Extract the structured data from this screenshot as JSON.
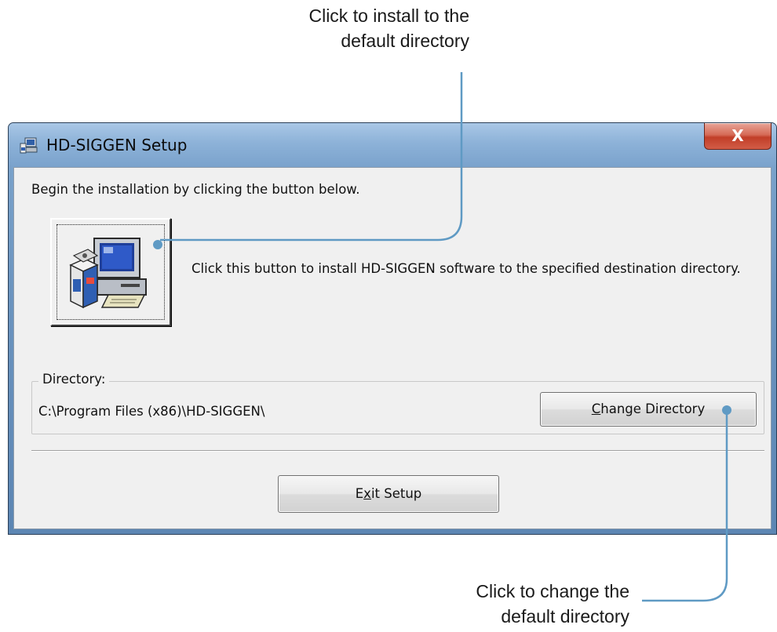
{
  "annotations": {
    "top": {
      "line1": "Click to install to the",
      "line2": "default directory"
    },
    "bottom": {
      "line1": "Click to change the",
      "line2": "default directory"
    },
    "line_color": "#5f9ac4"
  },
  "window": {
    "title": "HD-SIGGEN Setup",
    "close_label": "X",
    "title_icon": "setup-icon"
  },
  "content": {
    "prompt": "Begin the installation by clicking the button below.",
    "install_icon": "computer-install-icon",
    "install_description": "Click this button to install HD-SIGGEN software to the specified destination directory.",
    "directory_label": "Directory:",
    "directory_path": "C:\\Program Files (x86)\\HD-SIGGEN\\"
  },
  "buttons": {
    "change_directory_before": "",
    "change_directory_mnemonic": "C",
    "change_directory_after": "hange Directory",
    "exit_before": "E",
    "exit_mnemonic": "x",
    "exit_after": "it Setup"
  }
}
